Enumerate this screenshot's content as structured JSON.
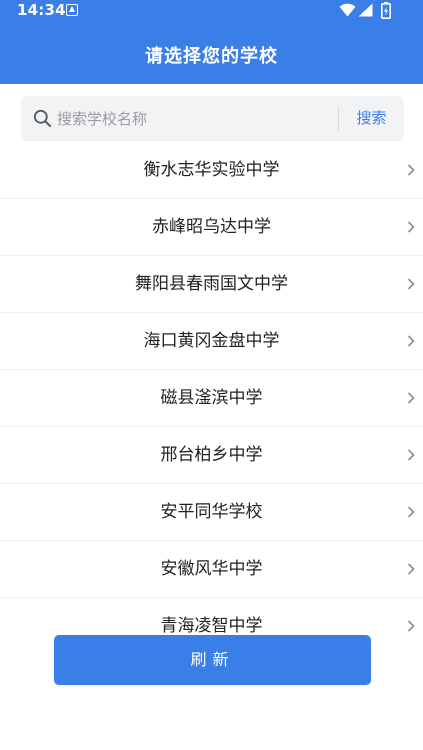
{
  "status_bar": {
    "time": "14:34",
    "icons": [
      "notification-a-icon",
      "wifi-icon",
      "signal-icon",
      "battery-charging-icon"
    ]
  },
  "header": {
    "title": "请选择您的学校"
  },
  "search": {
    "placeholder": "搜索学校名称",
    "value": "",
    "button_label": "搜索"
  },
  "schools": [
    "衡水志华实验中学",
    "赤峰昭乌达中学",
    "舞阳县春雨国文中学",
    "海口黄冈金盘中学",
    "磁县滏滨中学",
    "邢台柏乡中学",
    "安平同华学校",
    "安徽风华中学",
    "青海凌智中学"
  ],
  "refresh_label": "刷新",
  "colors": {
    "primary": "#3a7ee8",
    "search_bg": "#f2f3f5",
    "text": "#222222",
    "placeholder": "#9a9ca0",
    "divider": "#eceef0"
  }
}
